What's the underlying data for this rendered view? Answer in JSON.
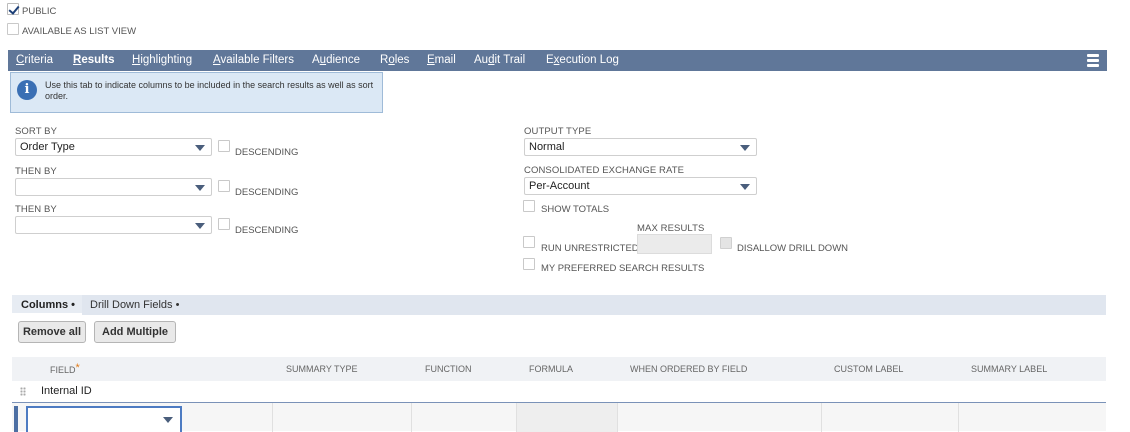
{
  "options": {
    "public_label": "PUBLIC",
    "public_checked": true,
    "list_view_label": "AVAILABLE AS LIST VIEW",
    "list_view_checked": false
  },
  "tabs": [
    {
      "label": "Criteria",
      "active": false
    },
    {
      "label": "Results",
      "active": true
    },
    {
      "label": "Highlighting",
      "active": false
    },
    {
      "label": "Available Filters",
      "active": false
    },
    {
      "label": "Audience",
      "active": false
    },
    {
      "label": "Roles",
      "active": false
    },
    {
      "label": "Email",
      "active": false
    },
    {
      "label": "Audit Trail",
      "active": false
    },
    {
      "label": "Execution Log",
      "active": false
    }
  ],
  "info": {
    "text": "Use this tab to indicate columns to be included in the search results as well as sort order."
  },
  "sort": {
    "sort_by_label": "SORT BY",
    "sort_by_value": "Order Type",
    "then_by_label_1": "THEN BY",
    "then_by_value_1": "",
    "then_by_label_2": "THEN BY",
    "then_by_value_2": "",
    "descending_label": "DESCENDING"
  },
  "output": {
    "output_type_label": "OUTPUT TYPE",
    "output_type_value": "Normal",
    "exchange_rate_label": "CONSOLIDATED EXCHANGE RATE",
    "exchange_rate_value": "Per-Account",
    "show_totals_label": "SHOW TOTALS",
    "max_results_label": "MAX RESULTS",
    "run_unrestricted_label": "RUN UNRESTRICTED",
    "disallow_drill_label": "DISALLOW DRILL DOWN",
    "preferred_results_label": "MY PREFERRED SEARCH RESULTS"
  },
  "sublist": {
    "tabs": [
      "Columns •",
      "Drill Down Fields •"
    ],
    "remove_all": "Remove all",
    "add_multiple": "Add Multiple",
    "headers": [
      "FIELD",
      "SUMMARY TYPE",
      "FUNCTION",
      "FORMULA",
      "WHEN ORDERED BY FIELD",
      "CUSTOM LABEL",
      "SUMMARY LABEL"
    ],
    "required_mark": "*",
    "rows": [
      {
        "field": "Internal ID"
      }
    ]
  },
  "colors": {
    "tab_bar": "#607799",
    "info_bg": "#dbe8f5",
    "accent": "#4d7bc2"
  }
}
